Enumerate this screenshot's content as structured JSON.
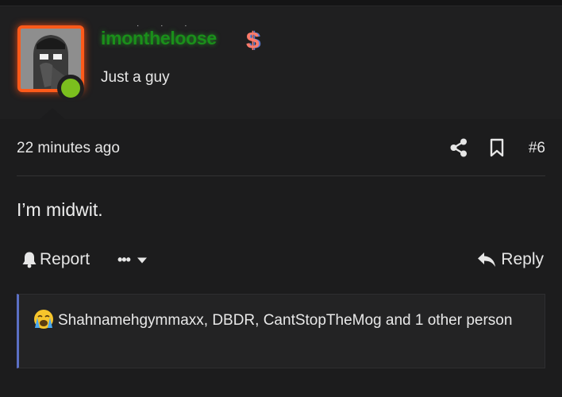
{
  "user": {
    "username": "imontheloose",
    "title": "Just a guy",
    "badge_icon": "dollar-icon",
    "badge_glyph": "$",
    "accent_username_color": "#1a8f1a",
    "avatar_border_color": "#ff5a1a",
    "online_dot_color": "#7bbf1e"
  },
  "post": {
    "timestamp": "22 minutes ago",
    "post_number": "#6",
    "body": "I’m midwit.",
    "share_icon": "share-icon",
    "bookmark_icon": "bookmark-icon"
  },
  "actions": {
    "report_label": "Report",
    "more_label": "•••",
    "reply_label": "Reply"
  },
  "reactions": {
    "emoji_icon": "crying-face-icon",
    "text": "Shahnamehgymmaxx, DBDR, CantStopTheMog and 1 other person",
    "accent_color": "#5b6fc4"
  }
}
